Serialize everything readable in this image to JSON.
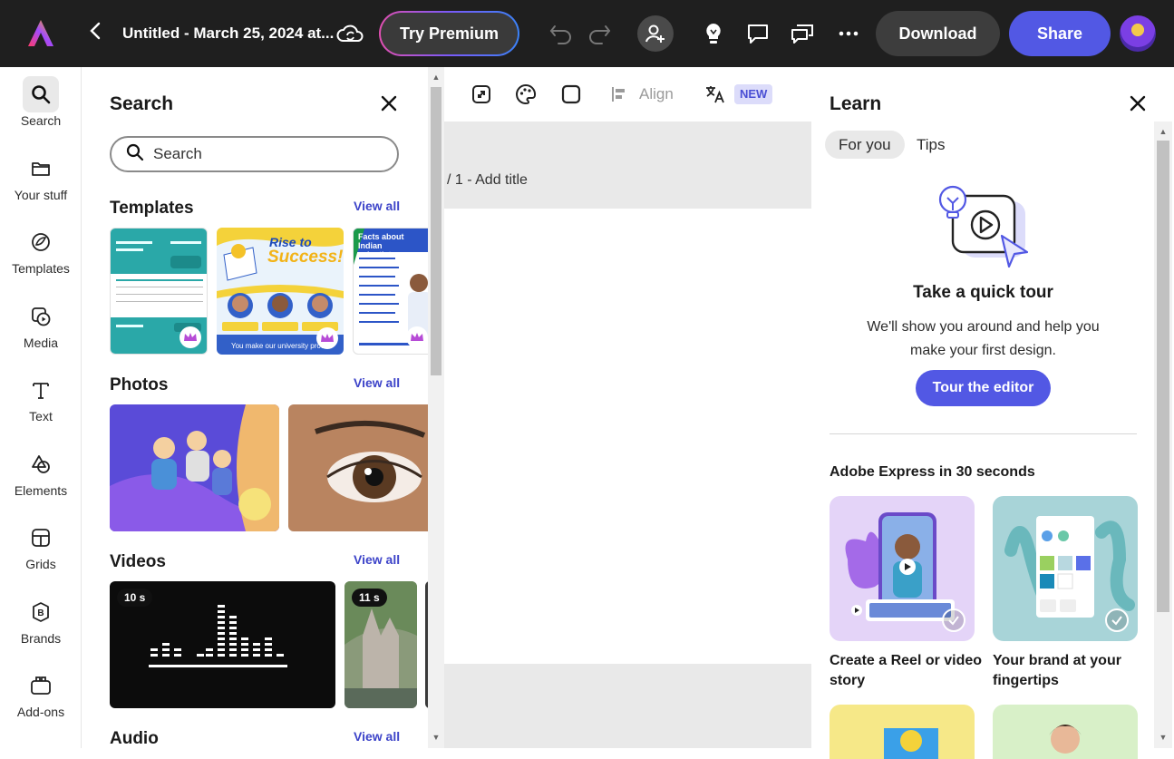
{
  "header": {
    "doc_title": "Untitled - March 25, 2024 at...",
    "premium_label": "Try Premium",
    "download_label": "Download",
    "share_label": "Share",
    "icons": [
      "adobe-express-logo",
      "back-chevron",
      "cloud-sync",
      "undo",
      "redo",
      "invite-person",
      "lightbulb",
      "comment",
      "comments-multi",
      "more"
    ]
  },
  "rail": {
    "items": [
      {
        "label": "Search",
        "icon": "search-icon"
      },
      {
        "label": "Your stuff",
        "icon": "folder-icon"
      },
      {
        "label": "Templates",
        "icon": "templates-icon"
      },
      {
        "label": "Media",
        "icon": "media-icon"
      },
      {
        "label": "Text",
        "icon": "text-icon"
      },
      {
        "label": "Elements",
        "icon": "elements-icon"
      },
      {
        "label": "Grids",
        "icon": "grids-icon"
      },
      {
        "label": "Brands",
        "icon": "brands-icon"
      },
      {
        "label": "Add-ons",
        "icon": "addons-icon"
      }
    ]
  },
  "search_panel": {
    "title": "Search",
    "search_placeholder": "Search",
    "templates_title": "Templates",
    "photos_title": "Photos",
    "videos_title": "Videos",
    "audio_title": "Audio",
    "view_all": "View all",
    "template2_text": "Rise to",
    "template2_text2": "Success!",
    "template3_text": "Facts about Indian scientists",
    "template2_footer": "You make our university proud",
    "video1_badge": "10 s",
    "video2_badge": "11 s"
  },
  "canvas": {
    "align_label": "Align",
    "new_badge": "NEW",
    "page_label": "/ 1 - Add title"
  },
  "learn": {
    "title": "Learn",
    "tabs": [
      "For you",
      "Tips"
    ],
    "tour_title": "Take a quick tour",
    "tour_desc": "We'll show you around and help you make your first design.",
    "tour_button": "Tour the editor",
    "section_title": "Adobe Express in 30 seconds",
    "cards": [
      {
        "label": "Create a Reel or video story"
      },
      {
        "label": "Your brand at your fingertips"
      }
    ]
  },
  "colors": {
    "accent": "#5258e4",
    "topbar": "#1f1f1f",
    "link": "#3d44c9"
  }
}
